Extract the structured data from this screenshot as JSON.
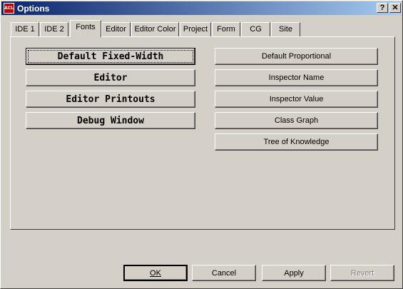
{
  "window": {
    "title": "Options",
    "icon_label": "ACL",
    "help_label": "?",
    "close_label": "✕"
  },
  "tabs": [
    {
      "label": "IDE 1"
    },
    {
      "label": "IDE 2"
    },
    {
      "label": "Fonts",
      "active": true
    },
    {
      "label": "Editor"
    },
    {
      "label": "Editor Color"
    },
    {
      "label": "Project"
    },
    {
      "label": "Form"
    },
    {
      "label": "CG"
    },
    {
      "label": "Site"
    }
  ],
  "fonts": {
    "left_buttons": [
      {
        "label": "Default Fixed-Width"
      },
      {
        "label": "Editor"
      },
      {
        "label": "Editor Printouts"
      },
      {
        "label": "Debug Window"
      }
    ],
    "right_buttons": [
      {
        "label": "Default Proportional"
      },
      {
        "label": "Inspector Name"
      },
      {
        "label": "Inspector Value"
      },
      {
        "label": "Class Graph"
      },
      {
        "label": "Tree of Knowledge"
      }
    ]
  },
  "footer": {
    "ok_label": "OK",
    "cancel_label": "Cancel",
    "apply_label": "Apply",
    "revert_label": "Revert"
  }
}
